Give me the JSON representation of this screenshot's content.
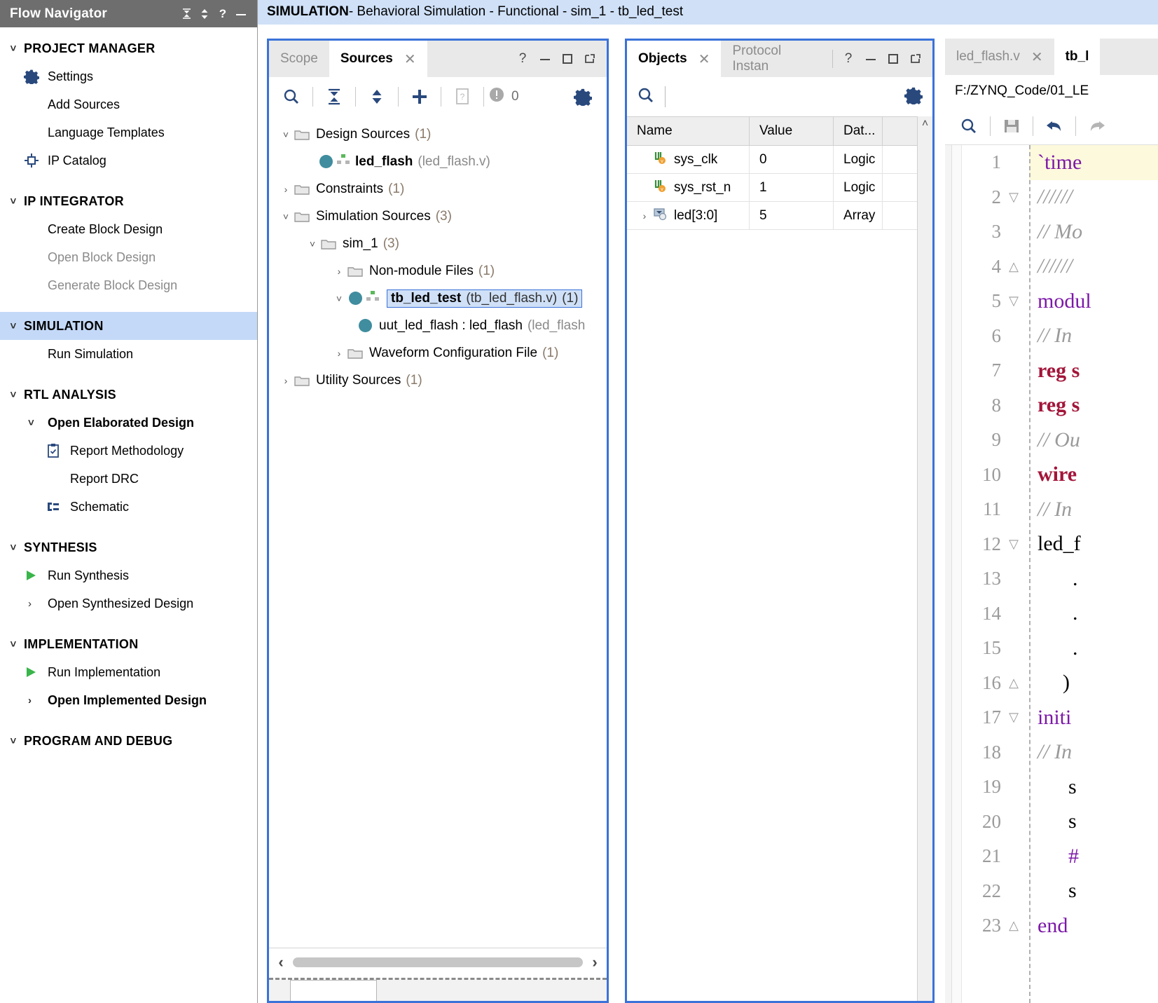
{
  "flow_navigator": {
    "title": "Flow Navigator",
    "title_buttons": [
      "collapse-all-icon",
      "expand-collapse-icon",
      "help-icon",
      "minimize-icon"
    ],
    "sections": [
      {
        "id": "project-manager",
        "label": "PROJECT MANAGER",
        "expanded": true,
        "active": false,
        "items": [
          {
            "label": "Settings",
            "icon": "gear-icon",
            "disabled": false,
            "bold": false
          },
          {
            "label": "Add Sources",
            "icon": "",
            "disabled": false,
            "bold": false
          },
          {
            "label": "Language Templates",
            "icon": "",
            "disabled": false,
            "bold": false
          },
          {
            "label": "IP Catalog",
            "icon": "ip-catalog-icon",
            "disabled": false,
            "bold": false
          }
        ]
      },
      {
        "id": "ip-integrator",
        "label": "IP INTEGRATOR",
        "expanded": true,
        "active": false,
        "items": [
          {
            "label": "Create Block Design",
            "icon": "",
            "disabled": false,
            "bold": false
          },
          {
            "label": "Open Block Design",
            "icon": "",
            "disabled": true,
            "bold": false
          },
          {
            "label": "Generate Block Design",
            "icon": "",
            "disabled": true,
            "bold": false
          }
        ]
      },
      {
        "id": "simulation",
        "label": "SIMULATION",
        "expanded": true,
        "active": true,
        "items": [
          {
            "label": "Run Simulation",
            "icon": "",
            "disabled": false,
            "bold": false
          }
        ]
      },
      {
        "id": "rtl-analysis",
        "label": "RTL ANALYSIS",
        "expanded": true,
        "active": false,
        "items": [
          {
            "label": "Open Elaborated Design",
            "icon": "chevron-down-icon",
            "disabled": false,
            "bold": true
          },
          {
            "label": "Report Methodology",
            "icon": "clipboard-check-icon",
            "disabled": false,
            "bold": false
          },
          {
            "label": "Report DRC",
            "icon": "",
            "disabled": false,
            "bold": false
          },
          {
            "label": "Schematic",
            "icon": "schematic-icon",
            "disabled": false,
            "bold": false
          }
        ]
      },
      {
        "id": "synthesis",
        "label": "SYNTHESIS",
        "expanded": true,
        "active": false,
        "items": [
          {
            "label": "Run Synthesis",
            "icon": "play-icon",
            "disabled": false,
            "bold": false
          },
          {
            "label": "Open Synthesized Design",
            "icon": "chevron-right-icon",
            "disabled": false,
            "bold": false
          }
        ]
      },
      {
        "id": "implementation",
        "label": "IMPLEMENTATION",
        "expanded": true,
        "active": false,
        "items": [
          {
            "label": "Run Implementation",
            "icon": "play-icon",
            "disabled": false,
            "bold": false
          },
          {
            "label": "Open Implemented Design",
            "icon": "chevron-right-icon",
            "disabled": false,
            "bold": true
          }
        ]
      },
      {
        "id": "program-and-debug",
        "label": "PROGRAM AND DEBUG",
        "expanded": true,
        "active": false,
        "items": []
      }
    ]
  },
  "sim_title": {
    "prefix": "SIMULATION",
    "rest": " - Behavioral Simulation - Functional - sim_1 - tb_led_test"
  },
  "sources_panel": {
    "tabs": [
      {
        "label": "Scope",
        "active": false,
        "closable": false
      },
      {
        "label": "Sources",
        "active": true,
        "closable": true
      }
    ],
    "window_controls": [
      "help-icon",
      "minimize-icon",
      "maximize-icon",
      "float-icon"
    ],
    "toolbar": {
      "buttons": [
        "search-icon",
        "collapse-all-icon",
        "expand-all-icon",
        "add-sources-icon",
        "report-icon"
      ],
      "message_count": "0",
      "settings": "gear-icon"
    },
    "tree": [
      {
        "indent": 0,
        "twisty": "down",
        "icon": "folder-icon",
        "label": "Design Sources",
        "count": "(1)",
        "file": "",
        "bold": false,
        "selected": false
      },
      {
        "indent": 1,
        "twisty": "",
        "icon": "module-icon",
        "label": "led_flash",
        "count": "",
        "file": "(led_flash.v)",
        "bold": true,
        "selected": false
      },
      {
        "indent": 0,
        "twisty": "right",
        "icon": "folder-icon",
        "label": "Constraints",
        "count": "(1)",
        "file": "",
        "bold": false,
        "selected": false
      },
      {
        "indent": 0,
        "twisty": "down",
        "icon": "folder-icon",
        "label": "Simulation Sources",
        "count": "(3)",
        "file": "",
        "bold": false,
        "selected": false
      },
      {
        "indent": 1,
        "twisty": "down",
        "icon": "folder-icon",
        "label": "sim_1",
        "count": "(3)",
        "file": "",
        "bold": false,
        "selected": false
      },
      {
        "indent": 2,
        "twisty": "right",
        "icon": "folder-icon",
        "label": "Non-module Files",
        "count": "(1)",
        "file": "",
        "bold": false,
        "selected": false
      },
      {
        "indent": 2,
        "twisty": "down",
        "icon": "module-icon",
        "label": "tb_led_test",
        "count": "(1)",
        "file": "(tb_led_flash.v)",
        "bold": true,
        "selected": true
      },
      {
        "indent": 3,
        "twisty": "",
        "icon": "instance-icon",
        "label": "uut_led_flash : led_flash",
        "count": "",
        "file": "(led_flash",
        "bold": false,
        "selected": false
      },
      {
        "indent": 2,
        "twisty": "right",
        "icon": "folder-icon",
        "label": "Waveform Configuration File",
        "count": "(1)",
        "file": "",
        "bold": false,
        "selected": false
      },
      {
        "indent": 0,
        "twisty": "right",
        "icon": "folder-icon",
        "label": "Utility Sources",
        "count": "(1)",
        "file": "",
        "bold": false,
        "selected": false
      }
    ],
    "hscroll": {
      "left_arrow": "chevron-left-icon",
      "right_arrow": "chevron-right-icon"
    }
  },
  "objects_panel": {
    "tabs": [
      {
        "label": "Objects",
        "active": true,
        "closable": true
      },
      {
        "label": "Protocol Instan",
        "active": false,
        "closable": false
      }
    ],
    "window_controls": [
      "help-icon",
      "minimize-icon",
      "maximize-icon",
      "float-icon"
    ],
    "search_placeholder": "",
    "settings": "gear-icon",
    "columns": [
      "Name",
      "Value",
      "Dat..."
    ],
    "rows": [
      {
        "twisty": "",
        "icon": "signal-icon",
        "name": "sys_clk",
        "value": "0",
        "datatype": "Logic"
      },
      {
        "twisty": "",
        "icon": "signal-icon",
        "name": "sys_rst_n",
        "value": "1",
        "datatype": "Logic"
      },
      {
        "twisty": "right",
        "icon": "array-icon",
        "name": "led[3:0]",
        "value": "5",
        "datatype": "Array"
      }
    ]
  },
  "code_panel": {
    "tabs": [
      {
        "label": "led_flash.v",
        "active": false,
        "closable": true
      },
      {
        "label": "tb_l",
        "active": true,
        "closable": false
      }
    ],
    "file_path": "F:/ZYNQ_Code/01_LE",
    "toolbar": [
      "search-icon",
      "save-icon",
      "undo-icon",
      "redo-icon"
    ],
    "lines": [
      {
        "no": "1",
        "fold": "",
        "highlight": true,
        "text": "`time",
        "cls": "dirk"
      },
      {
        "no": "2",
        "fold": "minus",
        "highlight": false,
        "text": "//////",
        "cls": "cmt"
      },
      {
        "no": "3",
        "fold": "",
        "highlight": false,
        "text": "// Mo",
        "cls": "cmt"
      },
      {
        "no": "4",
        "fold": "end",
        "highlight": false,
        "text": "//////",
        "cls": "cmt"
      },
      {
        "no": "5",
        "fold": "minus",
        "highlight": false,
        "text": "modul",
        "cls": "kw"
      },
      {
        "no": "6",
        "fold": "",
        "highlight": false,
        "text": "// In",
        "cls": "cmt"
      },
      {
        "no": "7",
        "fold": "",
        "highlight": false,
        "text": "reg s",
        "cls": "kw2"
      },
      {
        "no": "8",
        "fold": "",
        "highlight": false,
        "text": "reg s",
        "cls": "kw2"
      },
      {
        "no": "9",
        "fold": "",
        "highlight": false,
        "text": "// Ou",
        "cls": "cmt"
      },
      {
        "no": "10",
        "fold": "",
        "highlight": false,
        "text": "wire",
        "cls": "kw2"
      },
      {
        "no": "11",
        "fold": "",
        "highlight": false,
        "text": "// In",
        "cls": "cmt"
      },
      {
        "no": "12",
        "fold": "minus",
        "highlight": false,
        "text": "led_f",
        "cls": ""
      },
      {
        "no": "13",
        "fold": "",
        "highlight": false,
        "text": ".",
        "cls": ""
      },
      {
        "no": "14",
        "fold": "",
        "highlight": false,
        "text": ".",
        "cls": ""
      },
      {
        "no": "15",
        "fold": "",
        "highlight": false,
        "text": ".",
        "cls": ""
      },
      {
        "no": "16",
        "fold": "end",
        "highlight": false,
        "text": ")",
        "cls": ""
      },
      {
        "no": "17",
        "fold": "minus",
        "highlight": false,
        "text": "initi",
        "cls": "kw"
      },
      {
        "no": "18",
        "fold": "",
        "highlight": false,
        "text": "// In",
        "cls": "cmt"
      },
      {
        "no": "19",
        "fold": "",
        "highlight": false,
        "text": "s",
        "cls": ""
      },
      {
        "no": "20",
        "fold": "",
        "highlight": false,
        "text": "s",
        "cls": ""
      },
      {
        "no": "21",
        "fold": "",
        "highlight": false,
        "text": "#",
        "cls": "kw"
      },
      {
        "no": "22",
        "fold": "",
        "highlight": false,
        "text": "s",
        "cls": ""
      },
      {
        "no": "23",
        "fold": "end",
        "highlight": false,
        "text": "end",
        "cls": "kw"
      }
    ]
  },
  "colors": {
    "accent_blue": "#3b72d9",
    "title_bar_gray": "#6e6e6e",
    "selection_blue": "#cfe0f7",
    "module_teal": "#3f8d9e",
    "run_green": "#39b54a",
    "icon_blue": "#29497d"
  }
}
